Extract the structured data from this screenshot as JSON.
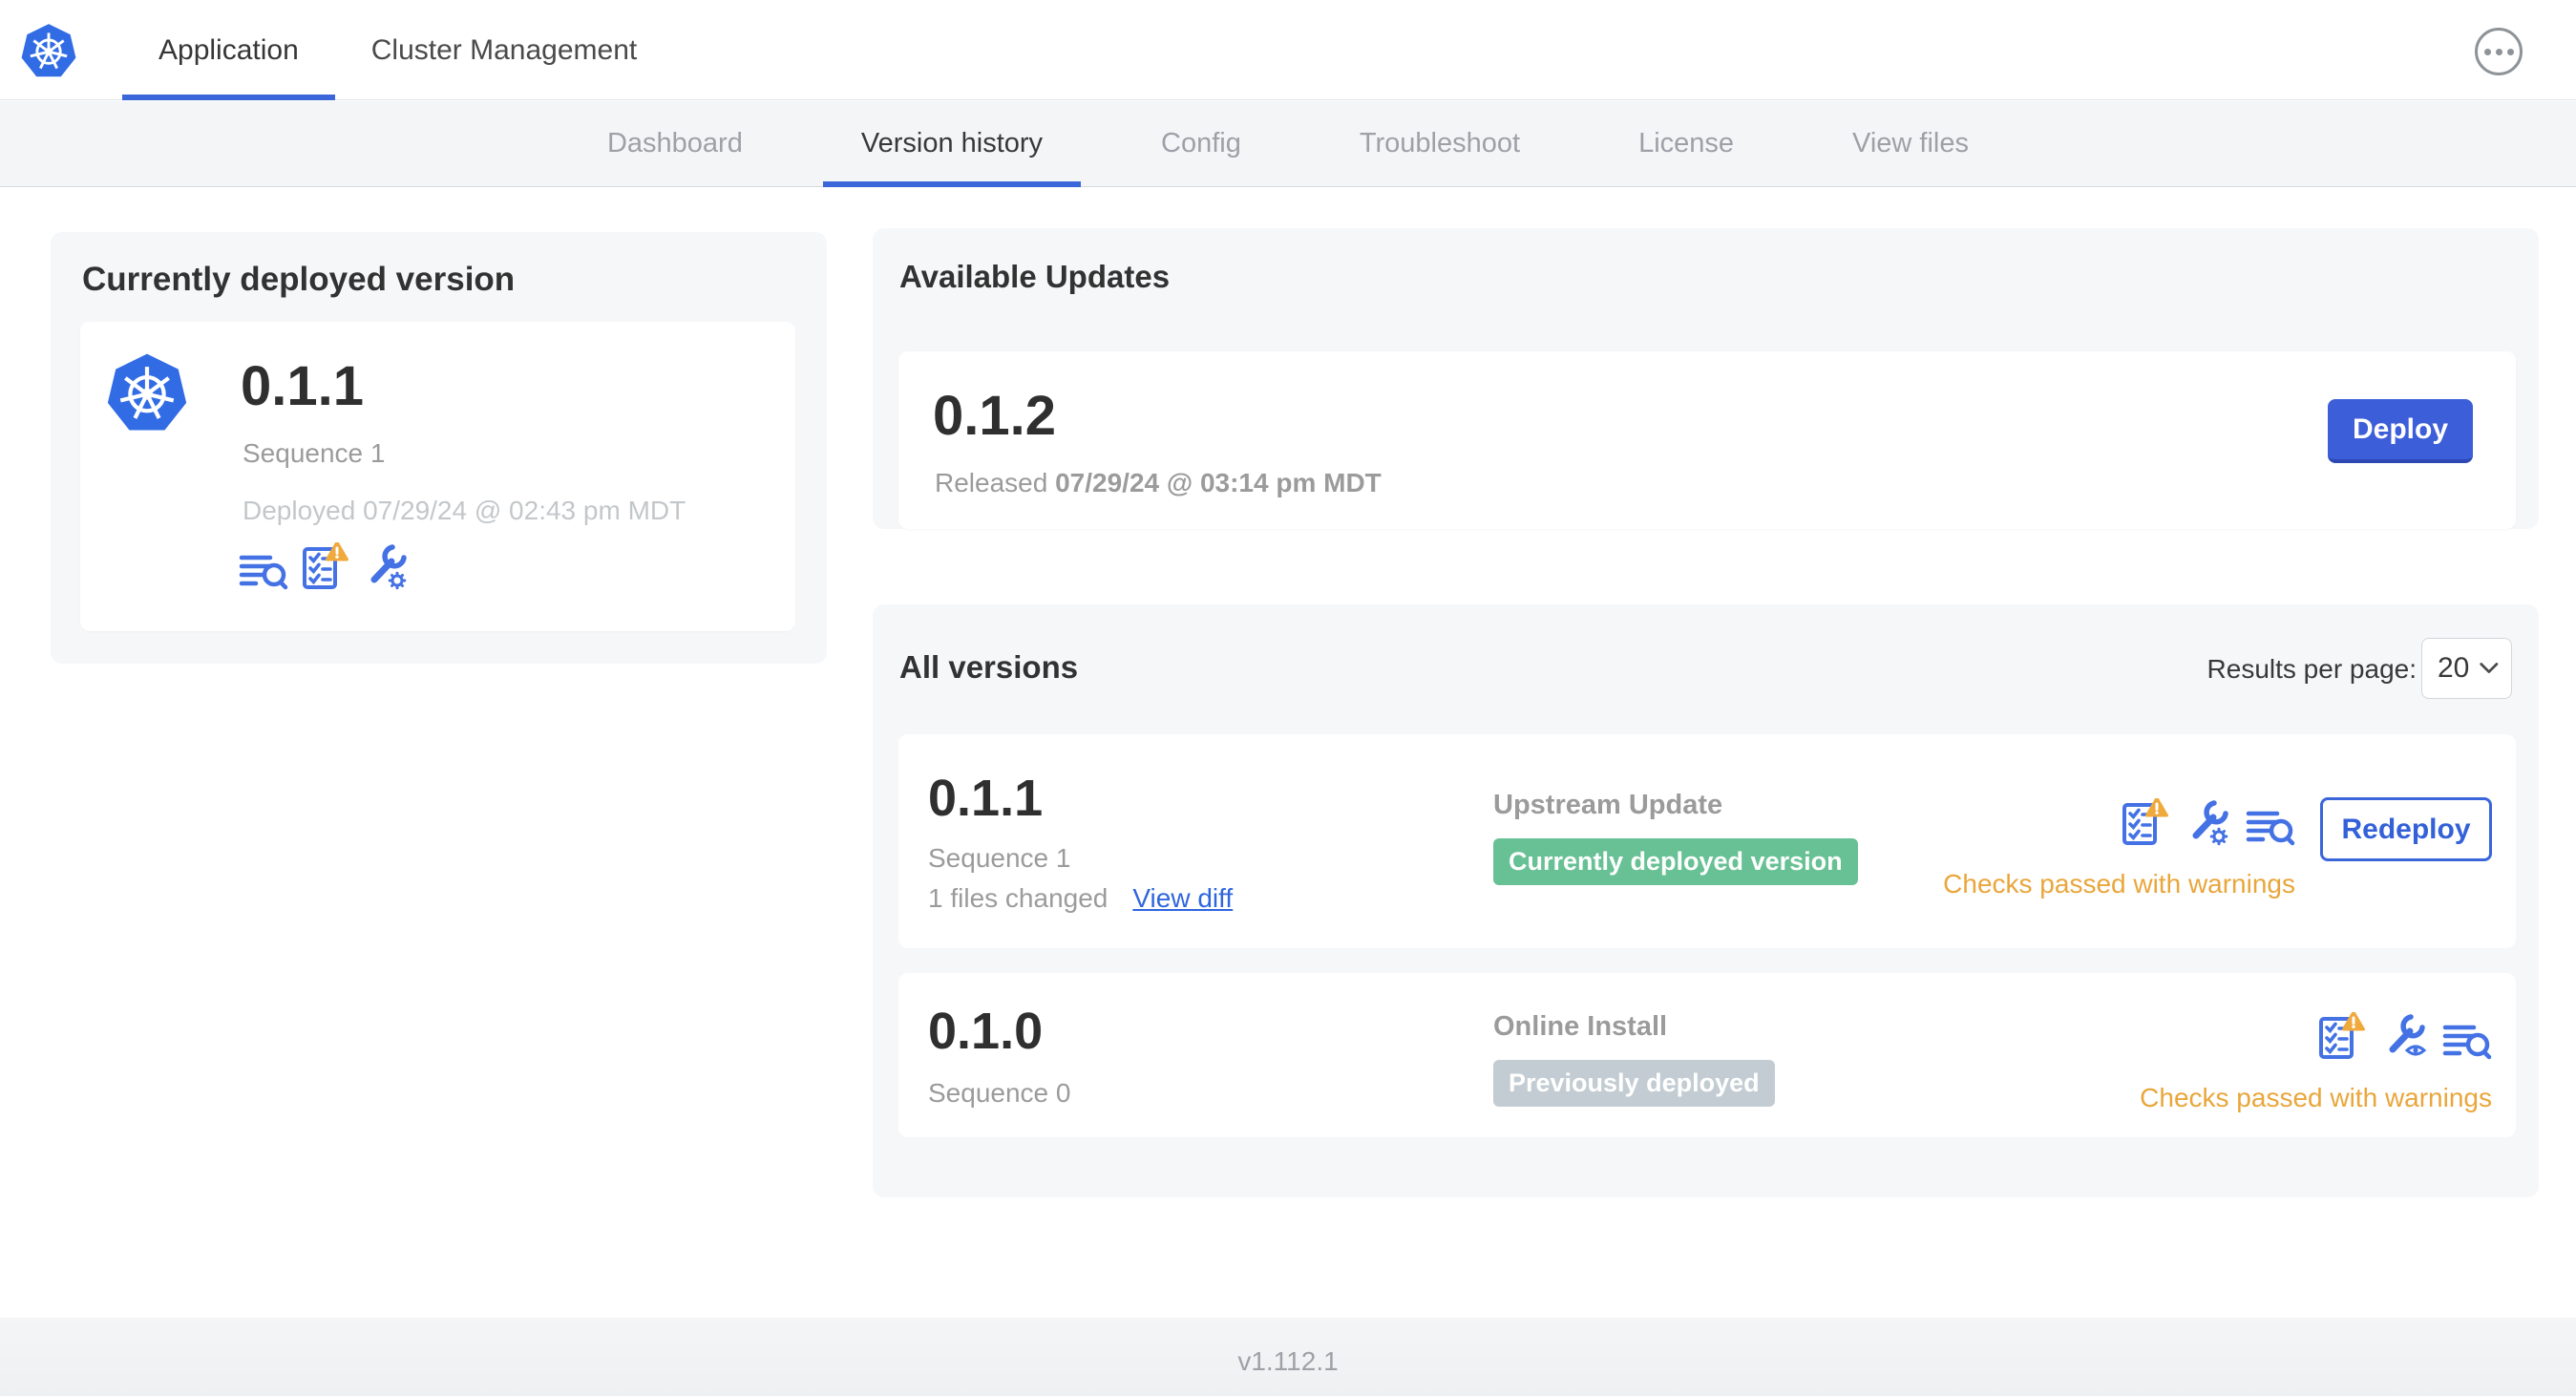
{
  "header": {
    "tabs": [
      {
        "label": "Application",
        "active": true
      },
      {
        "label": "Cluster Management",
        "active": false
      }
    ]
  },
  "subnav": {
    "tabs": [
      {
        "label": "Dashboard",
        "active": false
      },
      {
        "label": "Version history",
        "active": true
      },
      {
        "label": "Config",
        "active": false
      },
      {
        "label": "Troubleshoot",
        "active": false
      },
      {
        "label": "License",
        "active": false
      },
      {
        "label": "View files",
        "active": false
      }
    ]
  },
  "current_version_card": {
    "title": "Currently deployed version",
    "version": "0.1.1",
    "sequence": "Sequence 1",
    "deployed": "Deployed 07/29/24 @ 02:43 pm MDT",
    "icons": [
      "deploy-logs-icon",
      "preflight-checks-warning-icon",
      "edit-config-icon"
    ]
  },
  "available_updates": {
    "title": "Available Updates",
    "version": "0.1.2",
    "released_label": "Released",
    "released_date": "07/29/24 @ 03:14 pm MDT",
    "deploy_label": "Deploy"
  },
  "all_versions": {
    "title": "All versions",
    "results_per_page_label": "Results per page:",
    "results_per_page_value": "20",
    "rows": [
      {
        "version": "0.1.1",
        "sequence": "Sequence 1",
        "files_changed": "1 files changed",
        "view_diff_label": "View diff",
        "source": "Upstream Update",
        "badge_label": "Currently deployed version",
        "badge_color": "#67c194",
        "action_label": "Redeploy",
        "status": "Checks passed with warnings",
        "icons": [
          "preflight-checks-warning-icon",
          "edit-config-icon",
          "deploy-logs-icon"
        ]
      },
      {
        "version": "0.1.0",
        "sequence": "Sequence 0",
        "source": "Online Install",
        "badge_label": "Previously deployed",
        "badge_color": "#c2ccd2",
        "status": "Checks passed with warnings",
        "icons": [
          "preflight-checks-warning-icon",
          "view-config-icon",
          "deploy-logs-icon"
        ]
      }
    ]
  },
  "footer": {
    "app_version": "v1.112.1"
  },
  "colors": {
    "accent_blue": "#3b66d9",
    "button_blue": "#3d5ed9",
    "icon_blue": "#4472e4",
    "warning_amber": "#e9a63b",
    "badge_green": "#67c194",
    "badge_gray": "#c2ccd2",
    "kubernetes_blue": "#326ce5",
    "subnav_bg": "#f4f5f7",
    "card_bg": "#f6f7f9"
  }
}
